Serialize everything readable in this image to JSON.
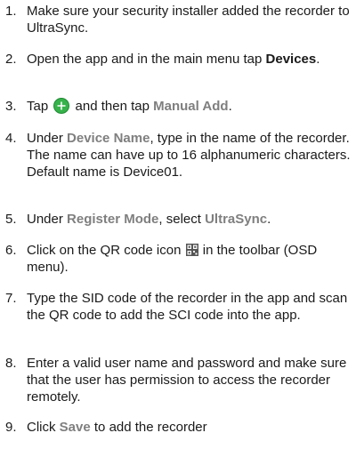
{
  "steps": [
    {
      "num": "1.",
      "text": "Make sure your security installer added the recorder to UltraSync."
    },
    {
      "num": "2.",
      "pre": "Open the app and in the main menu tap ",
      "bold": "Devices",
      "post": "."
    },
    {
      "num": "3.",
      "pre": "Tap ",
      "mid": " and then tap ",
      "highlight": "Manual Add",
      "post": "."
    },
    {
      "num": "4.",
      "pre": "Under ",
      "highlight": "Device Name",
      "post": ", type in the name of the recorder. The name can have up to 16 alphanumeric characters. Default name is Device01."
    },
    {
      "num": "5.",
      "pre": "Under ",
      "highlight1": "Register Mode",
      "mid": ", select ",
      "highlight2": "UltraSync",
      "post": "."
    },
    {
      "num": "6.",
      "pre": "Click on the QR code icon ",
      "post": " in the toolbar (OSD menu)."
    },
    {
      "num": "7.",
      "text": "Type the SID code of the recorder in the app and scan the QR code to add the SCI code into the app."
    },
    {
      "num": "8.",
      "text": "Enter a valid user name and password and make sure that the user has permission to access the recorder remotely."
    },
    {
      "num": "9.",
      "pre": "Click ",
      "highlight": "Save",
      "post": " to add the recorder"
    }
  ],
  "icons": {
    "add": "plus-circle-icon",
    "qr": "qr-code-icon"
  },
  "colors": {
    "highlight": "#7f7f7f",
    "add_icon": "#36b24a"
  }
}
